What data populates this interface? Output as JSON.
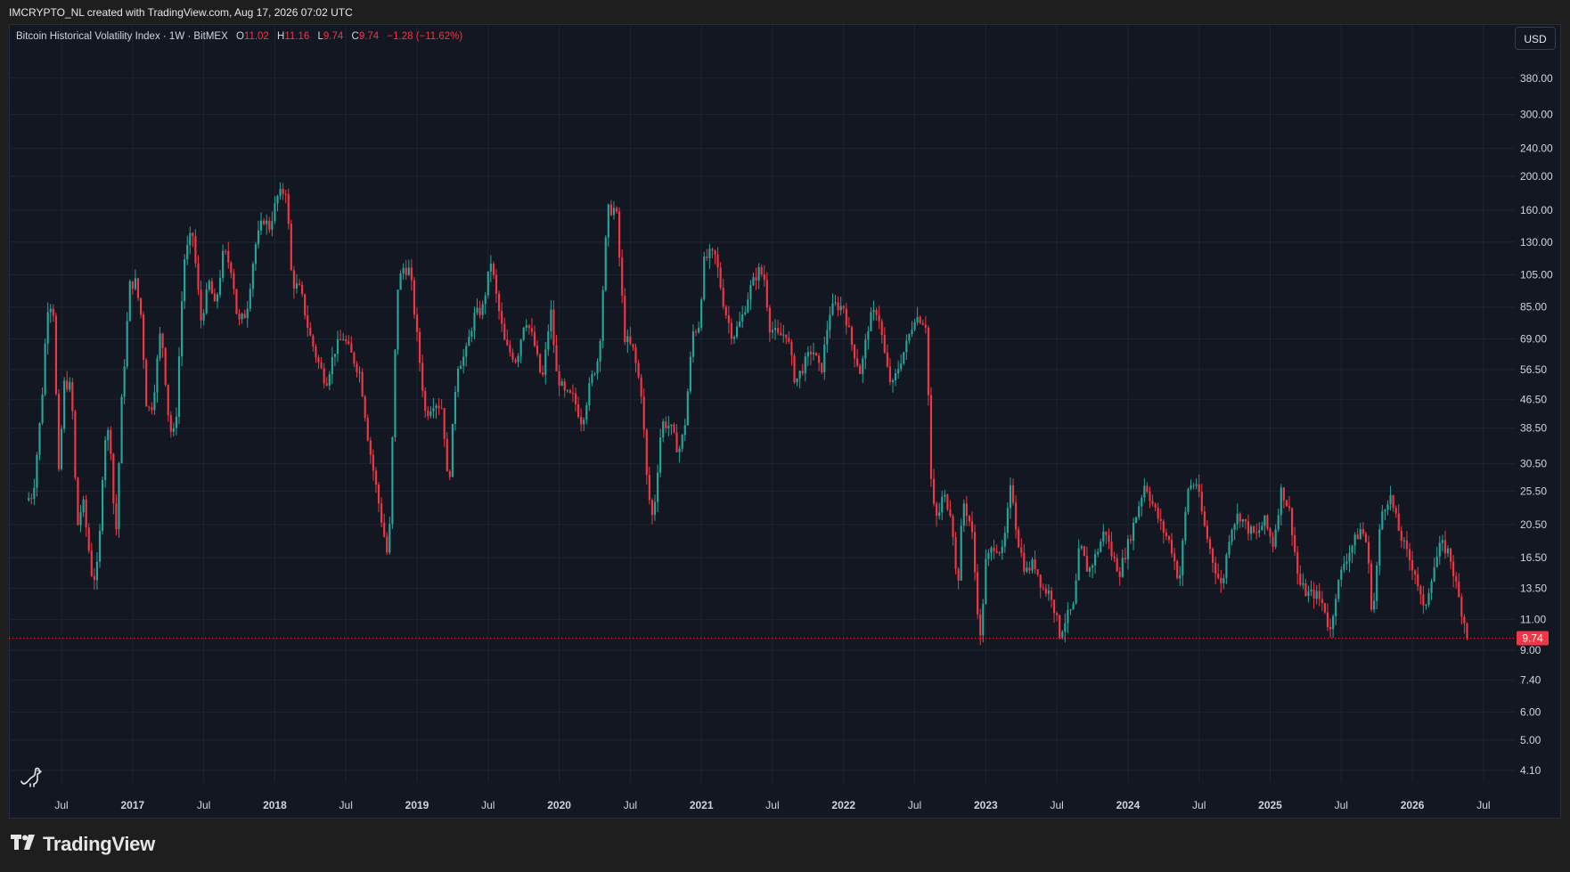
{
  "header": {
    "text": "IMCRYPTO_NL created with TradingView.com, Aug 17, 2026 07:02 UTC"
  },
  "legend": {
    "title": "Bitcoin Historical Volatility Index · 1W · BitMEX",
    "open_label": "O",
    "open": "11.02",
    "high_label": "H",
    "high": "11.16",
    "low_label": "L",
    "low": "9.74",
    "close_label": "C",
    "close": "9.74",
    "change": "−1.28 (−11.62%)"
  },
  "currency_button": "USD",
  "footer": {
    "brand": "TradingView"
  },
  "colors": {
    "up": "#26a69a",
    "down": "#f23645",
    "background": "#131722",
    "grid": "#1f2431"
  },
  "icons": [
    "tradingview-logo-icon",
    "dino-icon"
  ],
  "chart_data": {
    "type": "candlestick",
    "interval": "1W",
    "scale": "log",
    "ylim": [
      3.8,
      460
    ],
    "y_ticks": [
      380,
      300,
      240,
      200,
      160,
      130,
      105,
      85,
      69,
      56.5,
      46.5,
      38.5,
      30.5,
      25.5,
      20.5,
      16.5,
      13.5,
      11,
      9,
      7.4,
      6,
      5,
      4.1
    ],
    "y_tick_labels": [
      "380.00",
      "300.00",
      "240.00",
      "200.00",
      "160.00",
      "130.00",
      "105.00",
      "85.00",
      "69.00",
      "56.50",
      "46.50",
      "38.50",
      "30.50",
      "25.50",
      "20.50",
      "16.50",
      "13.50",
      "11.00",
      "9.00",
      "7.40",
      "6.00",
      "5.00",
      "4.10"
    ],
    "x_ticks": [
      {
        "label": "Jul",
        "t": 2016.5,
        "year": false
      },
      {
        "label": "2017",
        "t": 2017.0,
        "year": true
      },
      {
        "label": "Jul",
        "t": 2017.5,
        "year": false
      },
      {
        "label": "2018",
        "t": 2018.0,
        "year": true
      },
      {
        "label": "Jul",
        "t": 2018.5,
        "year": false
      },
      {
        "label": "2019",
        "t": 2019.0,
        "year": true
      },
      {
        "label": "Jul",
        "t": 2019.5,
        "year": false
      },
      {
        "label": "2020",
        "t": 2020.0,
        "year": true
      },
      {
        "label": "Jul",
        "t": 2020.5,
        "year": false
      },
      {
        "label": "2021",
        "t": 2021.0,
        "year": true
      },
      {
        "label": "Jul",
        "t": 2021.5,
        "year": false
      },
      {
        "label": "2022",
        "t": 2022.0,
        "year": true
      },
      {
        "label": "Jul",
        "t": 2022.5,
        "year": false
      },
      {
        "label": "2023",
        "t": 2023.0,
        "year": true
      },
      {
        "label": "Jul",
        "t": 2023.5,
        "year": false
      },
      {
        "label": "2024",
        "t": 2024.0,
        "year": true
      },
      {
        "label": "Jul",
        "t": 2024.5,
        "year": false
      },
      {
        "label": "2025",
        "t": 2025.0,
        "year": true
      },
      {
        "label": "Jul",
        "t": 2025.5,
        "year": false
      },
      {
        "label": "2026",
        "t": 2026.0,
        "year": true
      },
      {
        "label": "Jul",
        "t": 2026.5,
        "year": false
      }
    ],
    "x_range": [
      2016.13,
      2026.72
    ],
    "last_price": 9.74,
    "last_price_label": "9.74",
    "series_start": 2016.25,
    "anchors": [
      [
        2016.25,
        24
      ],
      [
        2016.3,
        25
      ],
      [
        2016.36,
        45
      ],
      [
        2016.4,
        85
      ],
      [
        2016.44,
        88
      ],
      [
        2016.48,
        28
      ],
      [
        2016.52,
        52
      ],
      [
        2016.57,
        50
      ],
      [
        2016.61,
        20
      ],
      [
        2016.65,
        24
      ],
      [
        2016.72,
        14
      ],
      [
        2016.76,
        16
      ],
      [
        2016.8,
        36
      ],
      [
        2016.84,
        38
      ],
      [
        2016.88,
        18
      ],
      [
        2016.92,
        44
      ],
      [
        2016.98,
        98
      ],
      [
        2017.02,
        100
      ],
      [
        2017.06,
        80
      ],
      [
        2017.1,
        43
      ],
      [
        2017.14,
        45
      ],
      [
        2017.2,
        75
      ],
      [
        2017.26,
        38
      ],
      [
        2017.3,
        37
      ],
      [
        2017.36,
        115
      ],
      [
        2017.42,
        140
      ],
      [
        2017.48,
        78
      ],
      [
        2017.54,
        100
      ],
      [
        2017.58,
        84
      ],
      [
        2017.64,
        123
      ],
      [
        2017.7,
        108
      ],
      [
        2017.74,
        76
      ],
      [
        2017.8,
        82
      ],
      [
        2017.86,
        126
      ],
      [
        2017.92,
        152
      ],
      [
        2017.96,
        143
      ],
      [
        2018.02,
        175
      ],
      [
        2018.08,
        184
      ],
      [
        2018.12,
        100
      ],
      [
        2018.18,
        95
      ],
      [
        2018.24,
        72
      ],
      [
        2018.3,
        60
      ],
      [
        2018.36,
        52
      ],
      [
        2018.42,
        64
      ],
      [
        2018.48,
        70
      ],
      [
        2018.54,
        62
      ],
      [
        2018.6,
        55
      ],
      [
        2018.66,
        35
      ],
      [
        2018.7,
        28
      ],
      [
        2018.76,
        20
      ],
      [
        2018.8,
        16
      ],
      [
        2018.86,
        95
      ],
      [
        2018.9,
        110
      ],
      [
        2018.95,
        108
      ],
      [
        2019.0,
        70
      ],
      [
        2019.06,
        42
      ],
      [
        2019.12,
        46
      ],
      [
        2019.18,
        44
      ],
      [
        2019.22,
        25
      ],
      [
        2019.28,
        58
      ],
      [
        2019.34,
        62
      ],
      [
        2019.4,
        80
      ],
      [
        2019.46,
        84
      ],
      [
        2019.52,
        115
      ],
      [
        2019.56,
        90
      ],
      [
        2019.62,
        66
      ],
      [
        2019.7,
        60
      ],
      [
        2019.76,
        80
      ],
      [
        2019.82,
        68
      ],
      [
        2019.88,
        52
      ],
      [
        2019.94,
        84
      ],
      [
        2019.98,
        55
      ],
      [
        2020.04,
        48
      ],
      [
        2020.1,
        47
      ],
      [
        2020.16,
        40
      ],
      [
        2020.22,
        52
      ],
      [
        2020.28,
        62
      ],
      [
        2020.34,
        160
      ],
      [
        2020.4,
        162
      ],
      [
        2020.46,
        70
      ],
      [
        2020.52,
        64
      ],
      [
        2020.58,
        48
      ],
      [
        2020.62,
        26
      ],
      [
        2020.66,
        21
      ],
      [
        2020.72,
        40
      ],
      [
        2020.78,
        39
      ],
      [
        2020.84,
        33
      ],
      [
        2020.88,
        38
      ],
      [
        2020.94,
        72
      ],
      [
        2020.98,
        75
      ],
      [
        2021.02,
        115
      ],
      [
        2021.06,
        120
      ],
      [
        2021.1,
        118
      ],
      [
        2021.16,
        85
      ],
      [
        2021.22,
        70
      ],
      [
        2021.28,
        78
      ],
      [
        2021.34,
        95
      ],
      [
        2021.4,
        108
      ],
      [
        2021.44,
        104
      ],
      [
        2021.48,
        75
      ],
      [
        2021.54,
        70
      ],
      [
        2021.6,
        72
      ],
      [
        2021.66,
        52
      ],
      [
        2021.72,
        58
      ],
      [
        2021.78,
        65
      ],
      [
        2021.84,
        55
      ],
      [
        2021.9,
        82
      ],
      [
        2021.94,
        86
      ],
      [
        2022.0,
        85
      ],
      [
        2022.06,
        66
      ],
      [
        2022.12,
        55
      ],
      [
        2022.18,
        78
      ],
      [
        2022.24,
        84
      ],
      [
        2022.3,
        58
      ],
      [
        2022.34,
        50
      ],
      [
        2022.4,
        60
      ],
      [
        2022.44,
        66
      ],
      [
        2022.5,
        80
      ],
      [
        2022.54,
        79
      ],
      [
        2022.58,
        76
      ],
      [
        2022.62,
        24
      ],
      [
        2022.66,
        21
      ],
      [
        2022.7,
        25
      ],
      [
        2022.76,
        22
      ],
      [
        2022.8,
        13
      ],
      [
        2022.84,
        24
      ],
      [
        2022.9,
        20
      ],
      [
        2022.96,
        9.5
      ],
      [
        2023.0,
        16
      ],
      [
        2023.06,
        18
      ],
      [
        2023.12,
        17
      ],
      [
        2023.18,
        27
      ],
      [
        2023.22,
        19
      ],
      [
        2023.28,
        15
      ],
      [
        2023.34,
        16
      ],
      [
        2023.4,
        13.5
      ],
      [
        2023.46,
        13
      ],
      [
        2023.52,
        10
      ],
      [
        2023.56,
        11
      ],
      [
        2023.62,
        12
      ],
      [
        2023.66,
        18
      ],
      [
        2023.72,
        15
      ],
      [
        2023.78,
        17
      ],
      [
        2023.84,
        20
      ],
      [
        2023.88,
        17
      ],
      [
        2023.94,
        15
      ],
      [
        2024.0,
        18
      ],
      [
        2024.06,
        22
      ],
      [
        2024.12,
        27
      ],
      [
        2024.18,
        23
      ],
      [
        2024.24,
        20
      ],
      [
        2024.3,
        18
      ],
      [
        2024.36,
        14
      ],
      [
        2024.42,
        26
      ],
      [
        2024.48,
        27
      ],
      [
        2024.54,
        20
      ],
      [
        2024.6,
        16
      ],
      [
        2024.66,
        13.5
      ],
      [
        2024.72,
        20
      ],
      [
        2024.78,
        22
      ],
      [
        2024.84,
        20
      ],
      [
        2024.9,
        19
      ],
      [
        2024.96,
        21
      ],
      [
        2025.02,
        18
      ],
      [
        2025.08,
        26
      ],
      [
        2025.14,
        22
      ],
      [
        2025.2,
        14
      ],
      [
        2025.26,
        13
      ],
      [
        2025.32,
        13
      ],
      [
        2025.38,
        12
      ],
      [
        2025.42,
        10
      ],
      [
        2025.46,
        13
      ],
      [
        2025.52,
        16
      ],
      [
        2025.58,
        18
      ],
      [
        2025.64,
        20
      ],
      [
        2025.68,
        18
      ],
      [
        2025.72,
        11
      ],
      [
        2025.78,
        22
      ],
      [
        2025.84,
        25
      ],
      [
        2025.9,
        20
      ],
      [
        2025.96,
        17
      ],
      [
        2026.02,
        15
      ],
      [
        2026.08,
        11.5
      ],
      [
        2026.14,
        15
      ],
      [
        2026.2,
        18
      ],
      [
        2026.26,
        17
      ],
      [
        2026.32,
        13
      ],
      [
        2026.36,
        11.02
      ],
      [
        2026.4,
        9.74
      ]
    ]
  }
}
